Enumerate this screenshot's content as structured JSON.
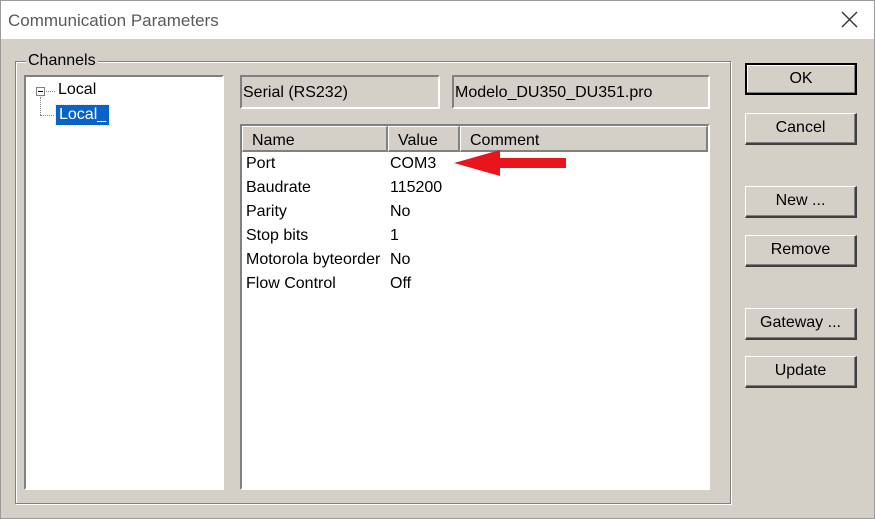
{
  "window": {
    "title": "Communication Parameters"
  },
  "channels": {
    "group_label": "Channels",
    "tree": {
      "root": "Local",
      "child": "Local_"
    }
  },
  "interface_field": "Serial (RS232)",
  "file_field": "Modelo_DU350_DU351.pro",
  "table": {
    "columns": [
      "Name",
      "Value",
      "Comment"
    ],
    "rows": [
      {
        "name": "Port",
        "value": "COM3"
      },
      {
        "name": "Baudrate",
        "value": "115200"
      },
      {
        "name": "Parity",
        "value": "No"
      },
      {
        "name": "Stop bits",
        "value": "1"
      },
      {
        "name": "Motorola byteorder",
        "value": "No"
      },
      {
        "name": "Flow Control",
        "value": "Off"
      }
    ]
  },
  "buttons": {
    "ok": "OK",
    "cancel": "Cancel",
    "new": "New ...",
    "remove": "Remove",
    "gateway": "Gateway ...",
    "update": "Update"
  },
  "icons": {
    "close": "close-icon",
    "annotation": "red-arrow-icon",
    "tree_toggle": "minus-box-icon"
  },
  "colors": {
    "selection": "#0a64c8",
    "arrow": "#e8161c",
    "dialog_bg": "#d4d0c8"
  }
}
